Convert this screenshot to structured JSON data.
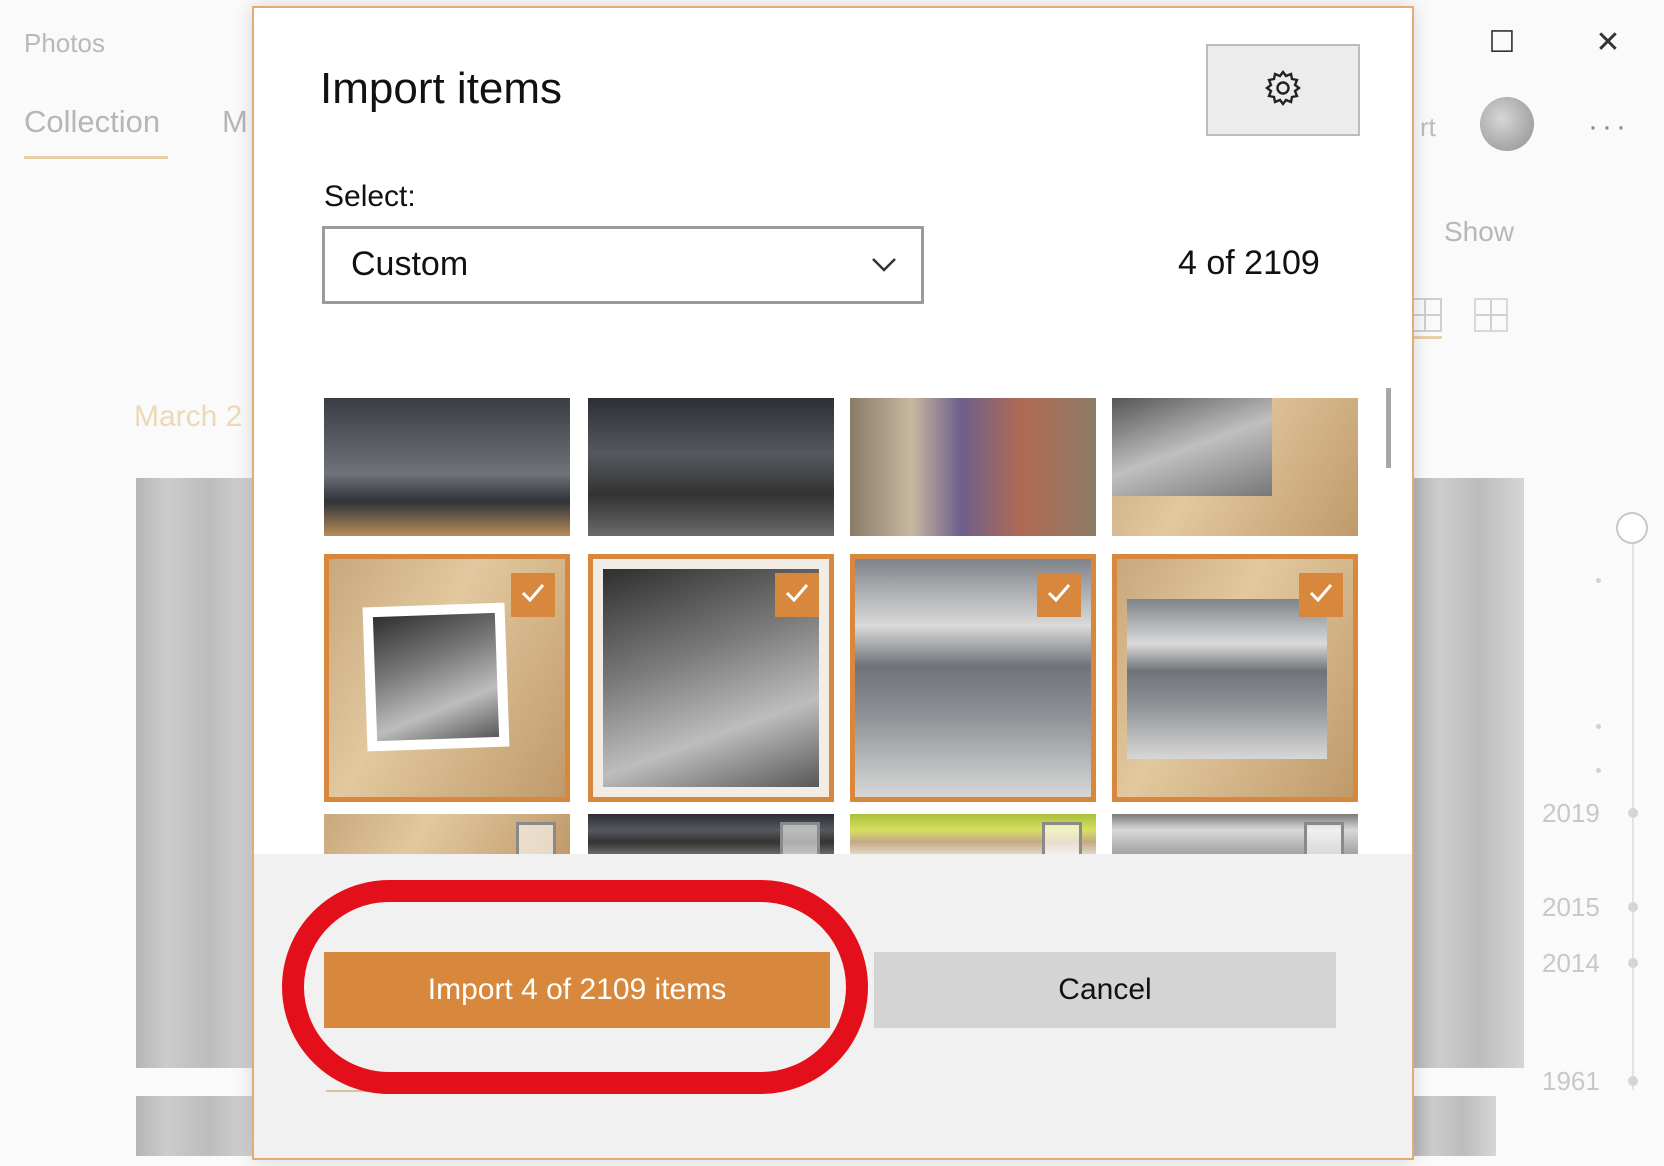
{
  "app": {
    "title": "Photos",
    "tabs": [
      "Collection",
      "M"
    ],
    "partial_label": "rt",
    "more_label": "···",
    "show_label": "Show",
    "date_header": "March 2",
    "timeline": {
      "years": [
        "2019",
        "2015",
        "2014",
        "1961"
      ]
    },
    "accent": "#d7883c",
    "window_controls": {
      "minimize": "–",
      "maximize": "☐",
      "close": "✕"
    }
  },
  "dialog": {
    "title": "Import items",
    "select_label": "Select:",
    "select_value": "Custom",
    "count_text": "4 of 2109",
    "thumbnails": [
      {
        "selected": false,
        "show_checkbox": false
      },
      {
        "selected": false,
        "show_checkbox": false
      },
      {
        "selected": false,
        "show_checkbox": false
      },
      {
        "selected": false,
        "show_checkbox": false
      },
      {
        "selected": true,
        "show_checkbox": true
      },
      {
        "selected": true,
        "show_checkbox": true
      },
      {
        "selected": true,
        "show_checkbox": true
      },
      {
        "selected": true,
        "show_checkbox": true
      },
      {
        "selected": false,
        "show_checkbox": true
      },
      {
        "selected": false,
        "show_checkbox": true
      },
      {
        "selected": false,
        "show_checkbox": true
      },
      {
        "selected": false,
        "show_checkbox": true
      }
    ],
    "import_button": "Import 4 of 2109 items",
    "cancel_button": "Cancel"
  },
  "icons": {
    "settings": "gear-icon",
    "dropdown": "chevron-down-icon",
    "check": "check-icon"
  }
}
